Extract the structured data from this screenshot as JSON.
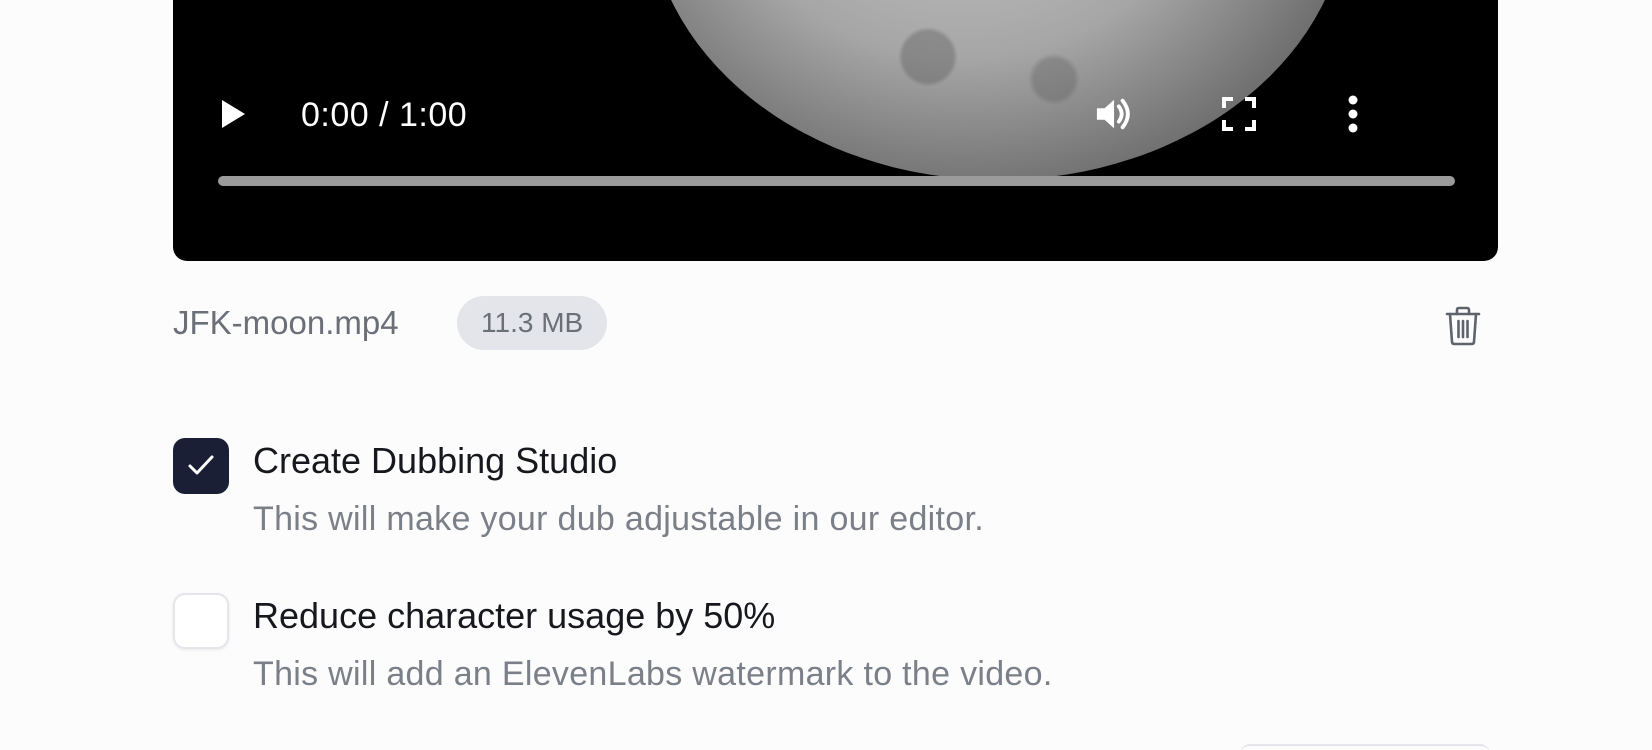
{
  "player": {
    "time_display": "0:00 / 1:00",
    "progress": 0,
    "icons": {
      "play": "play-icon",
      "volume": "volume-icon",
      "fullscreen": "fullscreen-icon",
      "more": "more-vertical-icon"
    }
  },
  "file": {
    "name": "JFK-moon.mp4",
    "size": "11.3 MB",
    "delete_icon": "trash-icon"
  },
  "options": [
    {
      "title": "Create Dubbing Studio",
      "description": "This will make your dub adjustable in our editor.",
      "checked": true
    },
    {
      "title": "Reduce character usage by 50%",
      "description": "This will add an ElevenLabs watermark to the video.",
      "checked": false
    }
  ],
  "colors": {
    "checkbox_checked": "#1b1f35",
    "badge_bg": "#e3e5ea",
    "muted_text": "#7b7f88"
  }
}
